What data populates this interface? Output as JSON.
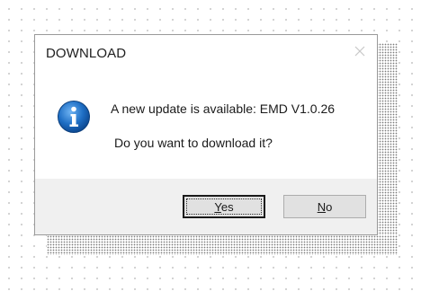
{
  "dialog": {
    "title": "DOWNLOAD",
    "message_line1": "A new update is available: EMD V1.0.26",
    "message_line2": "Do you want to download it?",
    "icon": "info-icon",
    "buttons": {
      "yes_label": "Yes",
      "no_label": "No"
    },
    "close_icon": "close-icon"
  },
  "colors": {
    "icon_blue": "#1f6fc5",
    "button_bar": "#f0f0f0",
    "button_face": "#e1e1e1"
  }
}
